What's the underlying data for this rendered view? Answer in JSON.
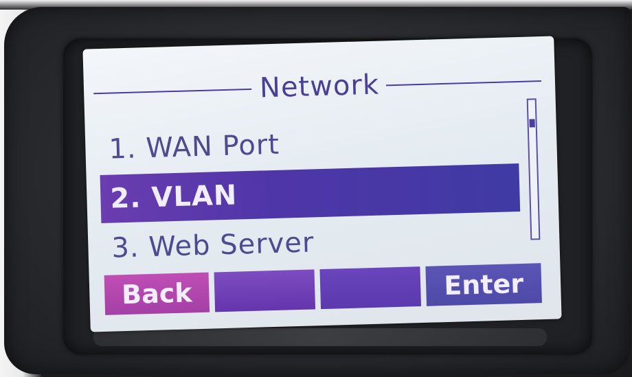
{
  "screen": {
    "title": "Network",
    "menu": {
      "items": [
        {
          "label": "1. WAN Port",
          "selected": false
        },
        {
          "label": "2. VLAN",
          "selected": true
        },
        {
          "label": "3. Web Server",
          "selected": false
        }
      ]
    },
    "softkeys": [
      {
        "label": "Back"
      },
      {
        "label": ""
      },
      {
        "label": ""
      },
      {
        "label": "Enter"
      }
    ],
    "scroll_position": 0.15
  },
  "colors": {
    "lcd_background": "#e8eef3",
    "text": "#4f4a8f",
    "highlight": "#4f36a8",
    "softkey_back": "#b047ad",
    "softkey": "#6535ae"
  }
}
